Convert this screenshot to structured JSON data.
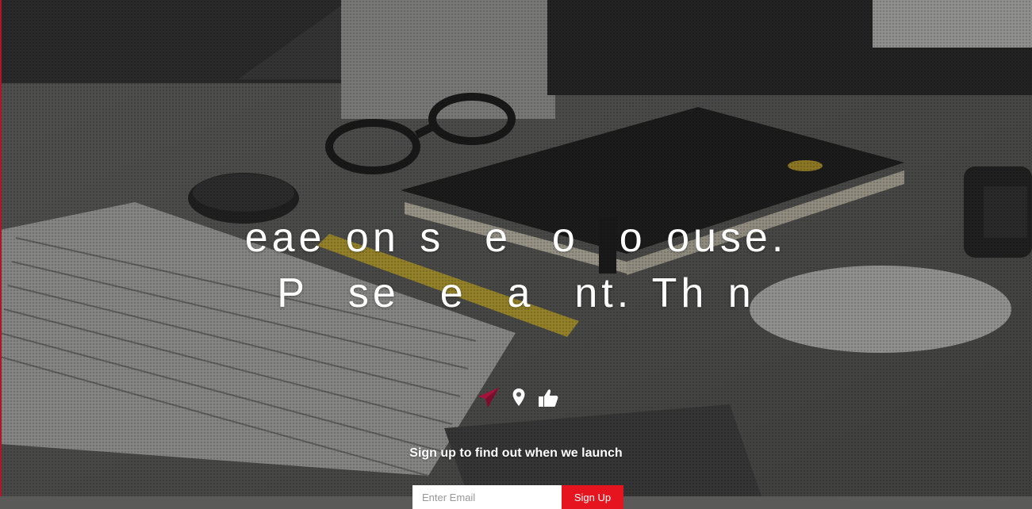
{
  "hero": {
    "line1": "eae on s  e  o  o ouse.",
    "line2": "P  se  e  a  nt. Th n"
  },
  "icons": {
    "send": "paper-plane-icon",
    "location": "map-marker-icon",
    "like": "thumbs-up-icon"
  },
  "signup": {
    "text": "Sign up to find out when we launch",
    "email_placeholder": "Enter Email",
    "button_label": "Sign Up"
  },
  "colors": {
    "accent": "#e5141e",
    "send_icon": "#a3133b"
  }
}
